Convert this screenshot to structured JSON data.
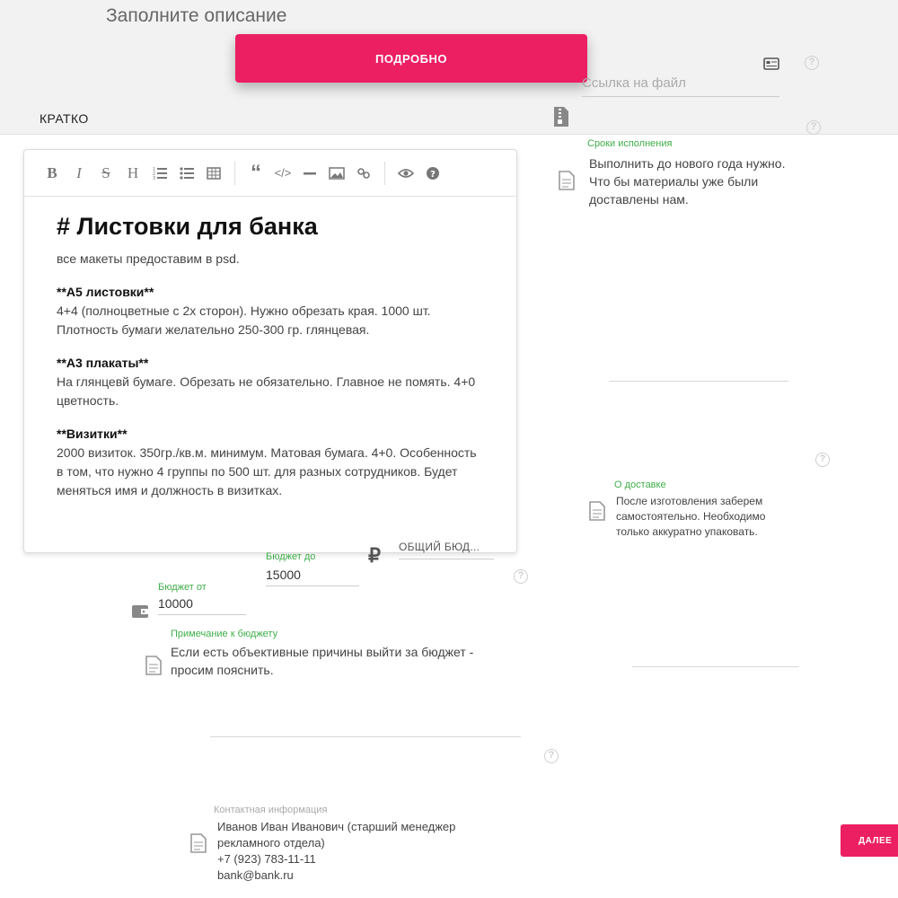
{
  "header": {
    "title": "Заполните описание",
    "tab_short": "КРАТКО",
    "tab_detailed": "ПОДРОБНО"
  },
  "editor": {
    "toolbar_top": [
      "quote-icon",
      "code-icon",
      "hr-icon",
      "image-icon",
      "link-icon",
      "preview-eye-icon",
      "help-icon"
    ],
    "toolbar": [
      "B",
      "I",
      "S",
      "H",
      "ordered-list-icon",
      "bullet-list-icon",
      "table-icon"
    ],
    "heading": "# Листовки для банка",
    "intro": "все макеты предоставим в psd.",
    "sections": [
      {
        "title": "**А5 листовки**",
        "text": "4+4 (полноцветные с 2х сторон). Нужно обрезать края. 1000 шт. Плотность бумаги желательно 250-300 гр. глянцевая."
      },
      {
        "title": "**А3 плакаты**",
        "text": "На глянцевй бумаге. Обрезать не обязательно. Главное не помять. 4+0 цветность."
      },
      {
        "title": "**Визитки**",
        "text": "2000 визиток. 350гр./кв.м. минимум. Матовая бумага. 4+0. Особенность в том, что нужно 4 группы по 500 шт. для разных сотрудников. Будет меняться имя и должность в визитках."
      }
    ]
  },
  "budget": {
    "from_label": "Бюджет от",
    "from_value": "10000",
    "to_label": "Бюджет до",
    "to_value": "15000",
    "currency_symbol": "₽",
    "total_placeholder": "ОБЩИЙ БЮД...",
    "note_label": "Примечание к бюджету",
    "note_text": "Если есть объективные причины выйти за бюджет - просим пояснить."
  },
  "contact": {
    "label": "Контактная информация",
    "text": "Иванов Иван Иванович (старший менеджер рекламного отдела)\n+7 (923) 783-11-11\nbank@bank.ru"
  },
  "right_panel": {
    "file_link_placeholder": "Ссылка на файл",
    "deadline_label": "Сроки исполнения",
    "deadline_text": "Выполнить до нового года нужно. Что бы материалы уже были доставлены нам.",
    "delivery_label": "О доставке",
    "delivery_text": "После изготовления заберем самостоятельно. Необходимо только аккуратно упаковать."
  },
  "footer": {
    "next_label": "ДАЛЕЕ"
  },
  "colors": {
    "accent": "#ec1f63",
    "label_green": "#3fae49"
  }
}
